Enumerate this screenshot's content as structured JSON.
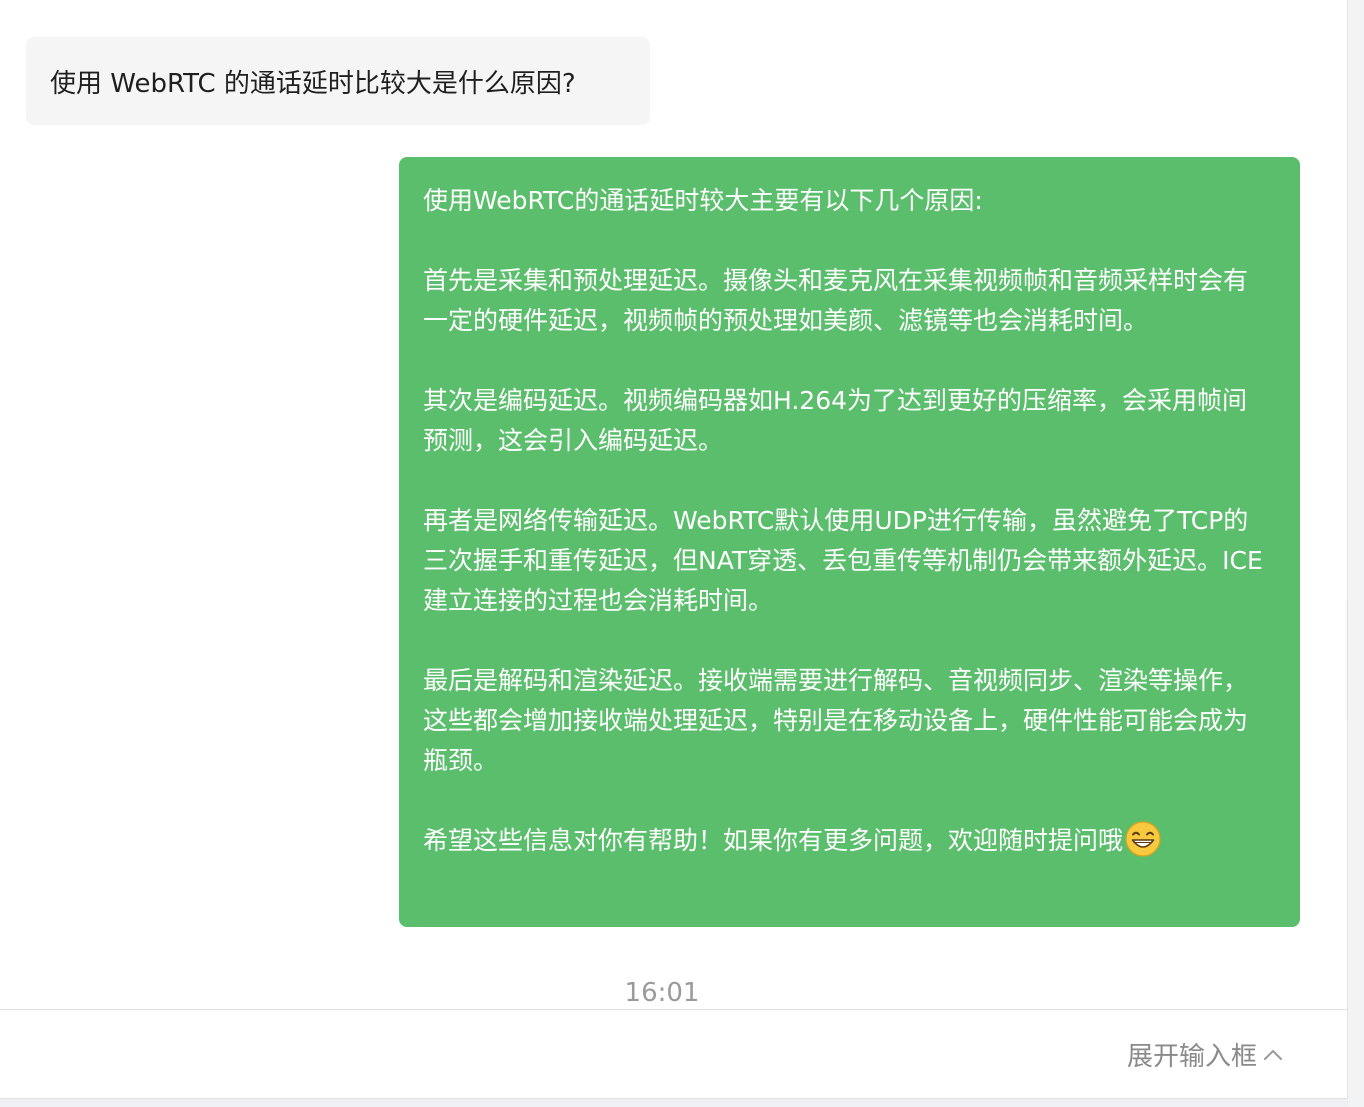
{
  "conversation": {
    "user_message": "使用 WebRTC 的通话延时比较大是什么原因?",
    "reply": {
      "paragraphs": [
        "使用WebRTC的通话延时较大主要有以下几个原因:",
        "首先是采集和预处理延迟。摄像头和麦克风在采集视频帧和音频采样时会有一定的硬件延迟，视频帧的预处理如美颜、滤镜等也会消耗时间。",
        "其次是编码延迟。视频编码器如H.264为了达到更好的压缩率，会采用帧间预测，这会引入编码延迟。",
        "再者是网络传输延迟。WebRTC默认使用UDP进行传输，虽然避免了TCP的三次握手和重传延迟，但NAT穿透、丢包重传等机制仍会带来额外延迟。ICE建立连接的过程也会消耗时间。",
        "最后是解码和渲染延迟。接收端需要进行解码、音视频同步、渲染等操作，这些都会增加接收端处理延迟，特别是在移动设备上，硬件性能可能会成为瓶颈。",
        "希望这些信息对你有帮助！如果你有更多问题，欢迎随时提问哦"
      ],
      "trailing_icon": "grinning-face-emoji-icon"
    },
    "timestamp": "16:01"
  },
  "input_area": {
    "expand_label": "展开输入框",
    "expand_icon": "chevron-up-icon"
  },
  "colors": {
    "reply_bubble": "#5bbe6c",
    "user_bubble": "#f5f5f6"
  }
}
